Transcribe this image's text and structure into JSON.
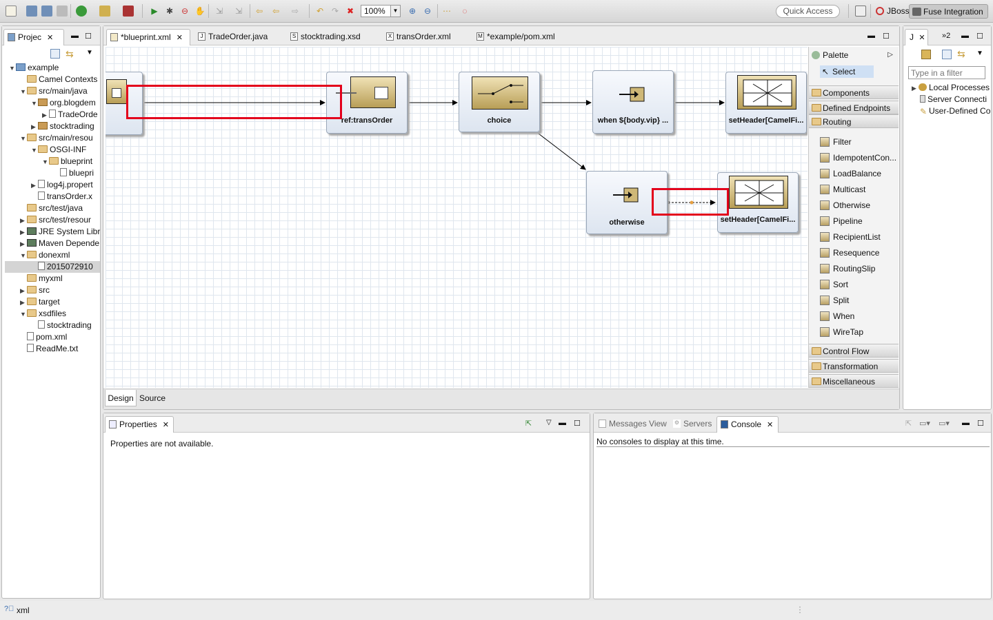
{
  "toolbar": {
    "zoom": "100%",
    "quick_access": "Quick Access",
    "perspectives": [
      "JBoss",
      "Fuse Integration"
    ]
  },
  "project_explorer": {
    "tab_label": "Projec",
    "items": [
      {
        "label": "example",
        "twisty": "open",
        "icon": "project"
      },
      {
        "label": "Camel Contexts",
        "twisty": "",
        "icon": "folder"
      },
      {
        "label": "src/main/java",
        "twisty": "open",
        "icon": "srcfolder"
      },
      {
        "label": "org.blogdem",
        "twisty": "open",
        "icon": "package"
      },
      {
        "label": "TradeOrde",
        "twisty": "closed",
        "icon": "java"
      },
      {
        "label": "stocktrading",
        "twisty": "closed",
        "icon": "package"
      },
      {
        "label": "src/main/resou",
        "twisty": "open",
        "icon": "srcfolder"
      },
      {
        "label": "OSGI-INF",
        "twisty": "open",
        "icon": "folder"
      },
      {
        "label": "blueprint",
        "twisty": "open",
        "icon": "folder"
      },
      {
        "label": "bluepri",
        "twisty": "",
        "icon": "file"
      },
      {
        "label": "log4j.propert",
        "twisty": "closed",
        "icon": "file"
      },
      {
        "label": "transOrder.x",
        "twisty": "",
        "icon": "file"
      },
      {
        "label": "src/test/java",
        "twisty": "",
        "icon": "srcfolder"
      },
      {
        "label": "src/test/resour",
        "twisty": "closed",
        "icon": "srcfolder"
      },
      {
        "label": "JRE System Libra",
        "twisty": "closed",
        "icon": "library"
      },
      {
        "label": "Maven Depende",
        "twisty": "closed",
        "icon": "library"
      },
      {
        "label": "donexml",
        "twisty": "open",
        "icon": "folder"
      },
      {
        "label": "2015072910",
        "twisty": "",
        "icon": "file"
      },
      {
        "label": "myxml",
        "twisty": "",
        "icon": "folder"
      },
      {
        "label": "src",
        "twisty": "closed",
        "icon": "folder"
      },
      {
        "label": "target",
        "twisty": "closed",
        "icon": "folder"
      },
      {
        "label": "xsdfiles",
        "twisty": "open",
        "icon": "folder"
      },
      {
        "label": "stocktrading",
        "twisty": "",
        "icon": "file"
      },
      {
        "label": "pom.xml",
        "twisty": "",
        "icon": "file"
      },
      {
        "label": "ReadMe.txt",
        "twisty": "",
        "icon": "file"
      }
    ]
  },
  "editor_tabs": [
    {
      "label": "*blueprint.xml",
      "active": true
    },
    {
      "label": "TradeOrder.java"
    },
    {
      "label": "stocktrading.xsd"
    },
    {
      "label": "transOrder.xml"
    },
    {
      "label": "*example/pom.xml"
    }
  ],
  "diagram": {
    "nodes": {
      "transorder": "ref:transOrder",
      "choice": "choice",
      "when": "when ${body.vip} ...",
      "setheader1": "setHeader[CamelFi...",
      "otherwise": "otherwise",
      "setheader2": "setHeader[CamelFi..."
    }
  },
  "palette": {
    "title": "Palette",
    "select": "Select",
    "drawers_top": [
      "Components",
      "Defined Endpoints",
      "Routing"
    ],
    "routing_items": [
      "Filter",
      "IdempotentCon...",
      "LoadBalance",
      "Multicast",
      "Otherwise",
      "Pipeline",
      "RecipientList",
      "Resequence",
      "RoutingSlip",
      "Sort",
      "Split",
      "When",
      "WireTap"
    ],
    "drawers_bottom": [
      "Control Flow",
      "Transformation",
      "Miscellaneous"
    ]
  },
  "editor_bottom_tabs": [
    "Design",
    "Source"
  ],
  "right_view": {
    "filter_placeholder": "Type in a filter",
    "items": [
      "Local Processes",
      "Server Connecti",
      "User-Defined Co"
    ]
  },
  "properties": {
    "tab_label": "Properties",
    "message": "Properties are not available."
  },
  "console_area": {
    "tabs": [
      "Messages View",
      "Servers",
      "Console"
    ],
    "message": "No consoles to display at this time."
  },
  "status": {
    "text": "xml"
  }
}
